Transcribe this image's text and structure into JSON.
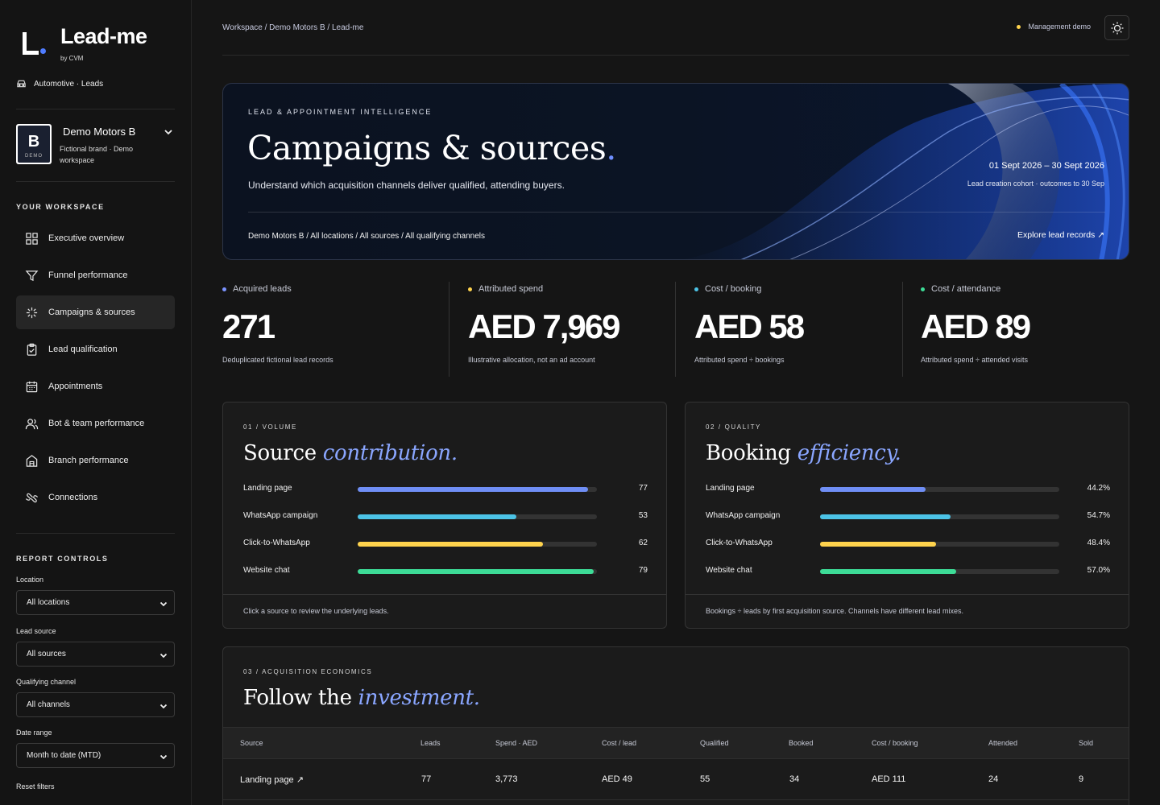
{
  "brand": {
    "name": "Lead-me",
    "by": "by CVM",
    "industry": "Automotive · Leads"
  },
  "workspace": {
    "logo_letter": "B",
    "logo_tag": "DEMO",
    "name": "Demo Motors B",
    "description": "Fictional brand · Demo workspace"
  },
  "nav": {
    "section_title": "YOUR WORKSPACE",
    "items": [
      {
        "label": "Executive overview",
        "icon": "grid-icon"
      },
      {
        "label": "Funnel performance",
        "icon": "funnel-icon"
      },
      {
        "label": "Campaigns & sources",
        "icon": "sparkle-icon"
      },
      {
        "label": "Lead qualification",
        "icon": "clipboard-check-icon"
      },
      {
        "label": "Appointments",
        "icon": "calendar-icon"
      },
      {
        "label": "Bot & team performance",
        "icon": "users-icon"
      },
      {
        "label": "Branch performance",
        "icon": "building-icon"
      },
      {
        "label": "Connections",
        "icon": "link-icon"
      }
    ]
  },
  "controls": {
    "section_title": "REPORT CONTROLS",
    "location": {
      "label": "Location",
      "value": "All locations"
    },
    "lead_source": {
      "label": "Lead source",
      "value": "All sources"
    },
    "channel": {
      "label": "Qualifying channel",
      "value": "All channels"
    },
    "date_range": {
      "label": "Date range",
      "value": "Month to date (MTD)"
    },
    "reset": "Reset filters"
  },
  "header": {
    "breadcrumb": "Workspace / Demo Motors B / Lead-me",
    "mode": "Management demo"
  },
  "hero": {
    "kicker": "LEAD & APPOINTMENT INTELLIGENCE",
    "title": "Campaigns & sources",
    "title_dot": ".",
    "subtitle": "Understand which acquisition channels deliver qualified, attending buyers.",
    "date_range": "01 Sept 2026 – 30 Sept 2026",
    "date_note": "Lead creation cohort · outcomes to 30 Sep",
    "scope": "Demo Motors B / All locations / All sources / All qualifying channels",
    "link": "Explore lead records ↗"
  },
  "kpis": [
    {
      "label": "Acquired leads",
      "value": "271",
      "note": "Deduplicated fictional lead records",
      "color": "#7b93ff"
    },
    {
      "label": "Attributed spend",
      "value": "AED 7,969",
      "note": "Illustrative allocation, not an ad account",
      "color": "#ffd34d"
    },
    {
      "label": "Cost / booking",
      "value": "AED 58",
      "note": "Attributed spend ÷ bookings",
      "color": "#4cc3e6"
    },
    {
      "label": "Cost / attendance",
      "value": "AED 89",
      "note": "Attributed spend ÷ attended visits",
      "color": "#3ddc97"
    }
  ],
  "volume": {
    "kicker": "01 / VOLUME",
    "title_plain": "Source ",
    "title_em": "contribution.",
    "max": 80,
    "rows": [
      {
        "label": "Landing page",
        "value": 77,
        "display": "77",
        "color": "#6f8ef5"
      },
      {
        "label": "WhatsApp campaign",
        "value": 53,
        "display": "53",
        "color": "#4cc3e6"
      },
      {
        "label": "Click-to-WhatsApp",
        "value": 62,
        "display": "62",
        "color": "#ffd34d"
      },
      {
        "label": "Website chat",
        "value": 79,
        "display": "79",
        "color": "#3ddc97"
      }
    ],
    "footnote": "Click a source to review the underlying leads."
  },
  "quality": {
    "kicker": "02 / QUALITY",
    "title_plain": "Booking ",
    "title_em": "efficiency.",
    "max": 100,
    "rows": [
      {
        "label": "Landing page",
        "value": 44.2,
        "display": "44.2%",
        "color": "#6f8ef5"
      },
      {
        "label": "WhatsApp campaign",
        "value": 54.7,
        "display": "54.7%",
        "color": "#4cc3e6"
      },
      {
        "label": "Click-to-WhatsApp",
        "value": 48.4,
        "display": "48.4%",
        "color": "#ffd34d"
      },
      {
        "label": "Website chat",
        "value": 57.0,
        "display": "57.0%",
        "color": "#3ddc97"
      }
    ],
    "footnote": "Bookings ÷ leads by first acquisition source. Channels have different lead mixes."
  },
  "economics": {
    "kicker": "03 / ACQUISITION ECONOMICS",
    "title_plain": "Follow the ",
    "title_em": "investment.",
    "columns": [
      "Source",
      "Leads",
      "Spend · AED",
      "Cost / lead",
      "Qualified",
      "Booked",
      "Cost / booking",
      "Attended",
      "Sold"
    ],
    "rows": [
      [
        "Landing page ↗",
        "77",
        "3,773",
        "AED 49",
        "55",
        "34",
        "AED 111",
        "24",
        "9"
      ]
    ]
  }
}
